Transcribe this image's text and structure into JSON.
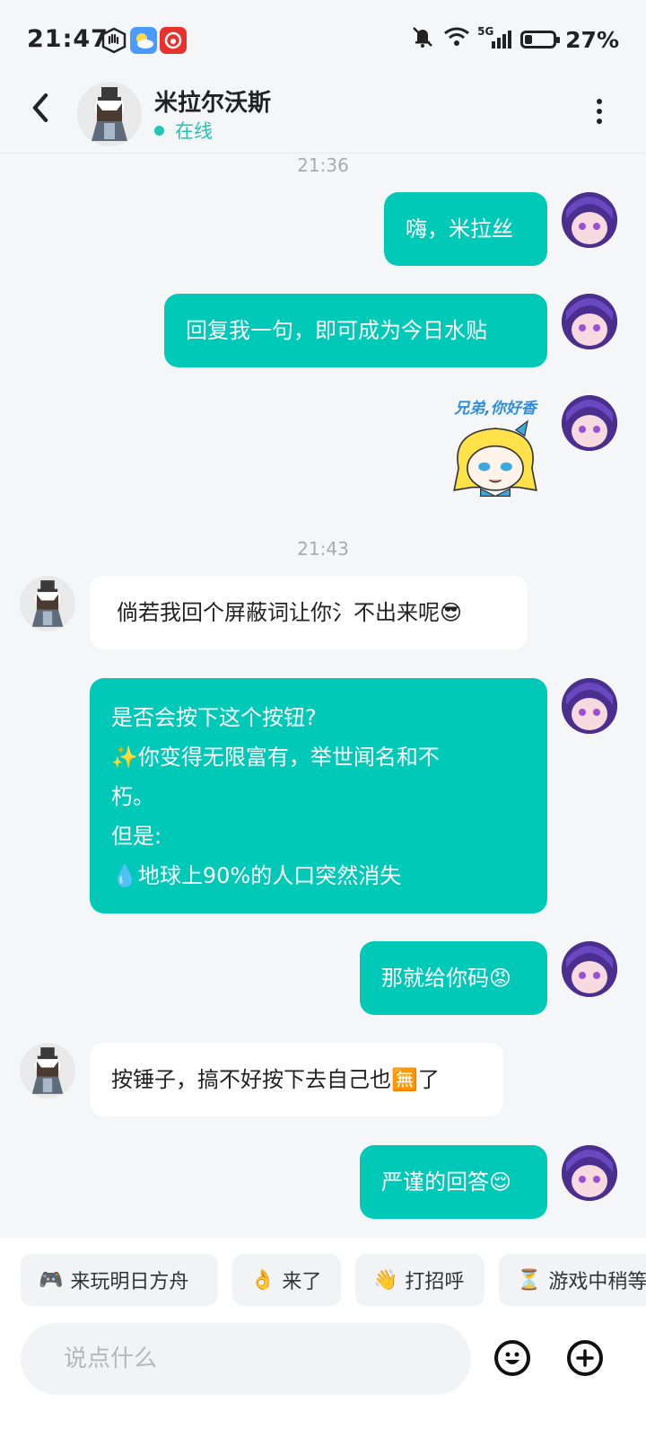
{
  "status_bar": {
    "time": "21:47",
    "signal_label": "5G",
    "battery": "27%",
    "battery_level": 0.27,
    "icons": [
      "hand-icon",
      "weather-icon",
      "netease-music-icon",
      "mute-icon",
      "wifi-icon",
      "signal-icon",
      "battery-icon"
    ]
  },
  "header": {
    "name": "米拉尔沃斯",
    "status": "在线",
    "icons": [
      "back-icon",
      "avatar",
      "more-icon"
    ]
  },
  "timestamps": [
    "21:36",
    "21:43"
  ],
  "messages": [
    {
      "side": "out",
      "text": "嗨，米拉丝"
    },
    {
      "side": "out",
      "text": "回复我一句，即可成为今日水贴"
    },
    {
      "side": "out",
      "type": "sticker",
      "text": "兄弟,你好香"
    },
    {
      "side": "in",
      "text": "倘若我回个屏蔽词让你氵不出来呢😎"
    },
    {
      "side": "out",
      "lines": [
        "是否会按下这个按钮?",
        "✨你变得无限富有，举世闻名和不",
        "朽。",
        "但是:",
        "💧地球上90%的人口突然消失"
      ]
    },
    {
      "side": "out",
      "text": "那就给你码😡"
    },
    {
      "side": "in",
      "text": "按锤子，搞不好按下去自己也🈚了"
    },
    {
      "side": "out",
      "text": "严谨的回答😌"
    }
  ],
  "quick_replies": [
    {
      "emoji": "🎮",
      "label": "来玩明日方舟"
    },
    {
      "emoji": "👌",
      "label": "来了"
    },
    {
      "emoji": "👋",
      "label": "打招呼"
    },
    {
      "emoji": "⏳",
      "label": "游戏中稍等"
    }
  ],
  "input": {
    "placeholder": "说点什么",
    "icons": [
      "emoji-icon",
      "plus-icon"
    ]
  },
  "colors": {
    "accent": "#00c9b8",
    "online": "#1fc5b5",
    "background": "#f5f6f8"
  }
}
